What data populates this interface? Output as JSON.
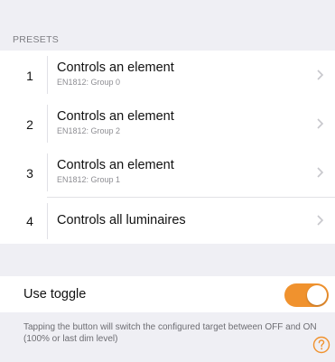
{
  "section_header": "PRESETS",
  "presets": [
    {
      "number": "1",
      "title": "Controls an element",
      "subtitle": "EN1812: Group 0"
    },
    {
      "number": "2",
      "title": "Controls an element",
      "subtitle": "EN1812: Group 2"
    },
    {
      "number": "3",
      "title": "Controls an element",
      "subtitle": "EN1812: Group 1"
    },
    {
      "number": "4",
      "title": "Controls all luminaires"
    }
  ],
  "toggle": {
    "label": "Use toggle",
    "on": true,
    "accent_color": "#f0922e"
  },
  "help_text": "Tapping the button will switch the configured target between OFF and ON (100% or last dim level)",
  "icons": {
    "chevron": "chevron-right-icon",
    "help": "question-mark-circle-icon"
  }
}
